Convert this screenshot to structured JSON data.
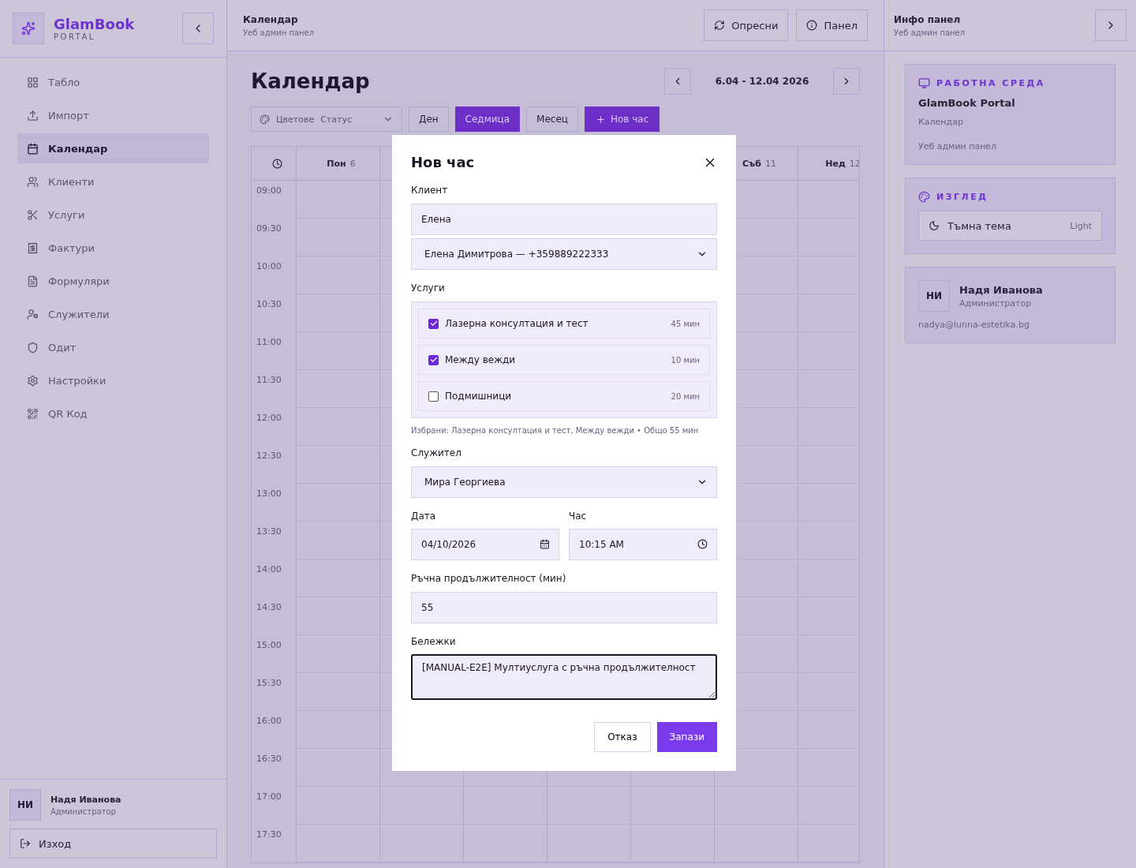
{
  "brand": {
    "name": "GlamBook",
    "sub": "PORTAL"
  },
  "nav": [
    {
      "label": "Табло",
      "selected": false
    },
    {
      "label": "Импорт",
      "selected": false
    },
    {
      "label": "Календар",
      "selected": true
    },
    {
      "label": "Клиенти",
      "selected": false
    },
    {
      "label": "Услуги",
      "selected": false
    },
    {
      "label": "Фактури",
      "selected": false
    },
    {
      "label": "Формуляри",
      "selected": false
    },
    {
      "label": "Служители",
      "selected": false
    },
    {
      "label": "Одит",
      "selected": false
    },
    {
      "label": "Настройки",
      "selected": false
    },
    {
      "label": "QR Код",
      "selected": false
    }
  ],
  "user": {
    "initials": "НИ",
    "name": "Надя Иванова",
    "role": "Администратор"
  },
  "logout": "Изход",
  "header": {
    "title": "Календар",
    "subtitle": "Уеб админ панел",
    "buttons": [
      "Опресни",
      "Панел"
    ]
  },
  "calendar": {
    "title": "Календар",
    "range": "6.04 - 12.04 2026",
    "color_label": "Цветове",
    "color_value": "Статус",
    "views": [
      {
        "label": "Ден",
        "selected": false
      },
      {
        "label": "Седмица",
        "selected": true
      },
      {
        "label": "Месец",
        "selected": false
      }
    ],
    "new_button": "Нов час",
    "days": [
      {
        "name": "Пон",
        "num": "6"
      },
      {
        "name": "Съб",
        "num": "11"
      },
      {
        "name": "Нед",
        "num": "12"
      }
    ],
    "times": [
      "09:00",
      "09:30",
      "10:00",
      "10:30",
      "11:00",
      "11:30",
      "12:00",
      "12:30",
      "13:00",
      "13:30",
      "14:00",
      "14:30",
      "15:00",
      "15:30",
      "16:00",
      "16:30",
      "17:00",
      "17:30"
    ]
  },
  "info_panel": {
    "title": "Инфо панел",
    "subtitle": "Уеб админ панел",
    "workspace": {
      "heading": "РАБОТНА СРЕДА",
      "name": "GlamBook Portal",
      "page": "Календар",
      "desc": "Уеб админ панел"
    },
    "view": {
      "heading": "ИЗГЛЕД",
      "toggle": "Тъмна тема",
      "value": "Light"
    },
    "user": {
      "initials": "НИ",
      "name": "Надя Иванова",
      "role": "Администратор",
      "email": "nadya@lunna-estetika.bg"
    }
  },
  "dialog": {
    "title": "Нов час",
    "client_label": "Клиент",
    "client_search": "Елена",
    "client_select": "Елена Димитрова — +359889222333",
    "services_label": "Услуги",
    "services": [
      {
        "name": "Лазерна консултация и тест",
        "duration": "45 мин",
        "checked": true
      },
      {
        "name": "Между вежди",
        "duration": "10 мин",
        "checked": true
      },
      {
        "name": "Подмишници",
        "duration": "20 мин",
        "checked": false
      }
    ],
    "summary": "Избрани: Лазерна консултация и тест, Между вежди • Общо 55 мин",
    "staff_label": "Служител",
    "staff": "Мира Георгиева",
    "date_label": "Дата",
    "date": "04/10/2026",
    "time_label": "Час",
    "time": "10:15 AM",
    "duration_label": "Ръчна продължителност (мин)",
    "duration": "55",
    "notes_label": "Бележки",
    "notes": "[MANUAL-E2E] Мултиуслуга с ръчна продължителност",
    "cancel": "Отказ",
    "save": "Запази"
  }
}
